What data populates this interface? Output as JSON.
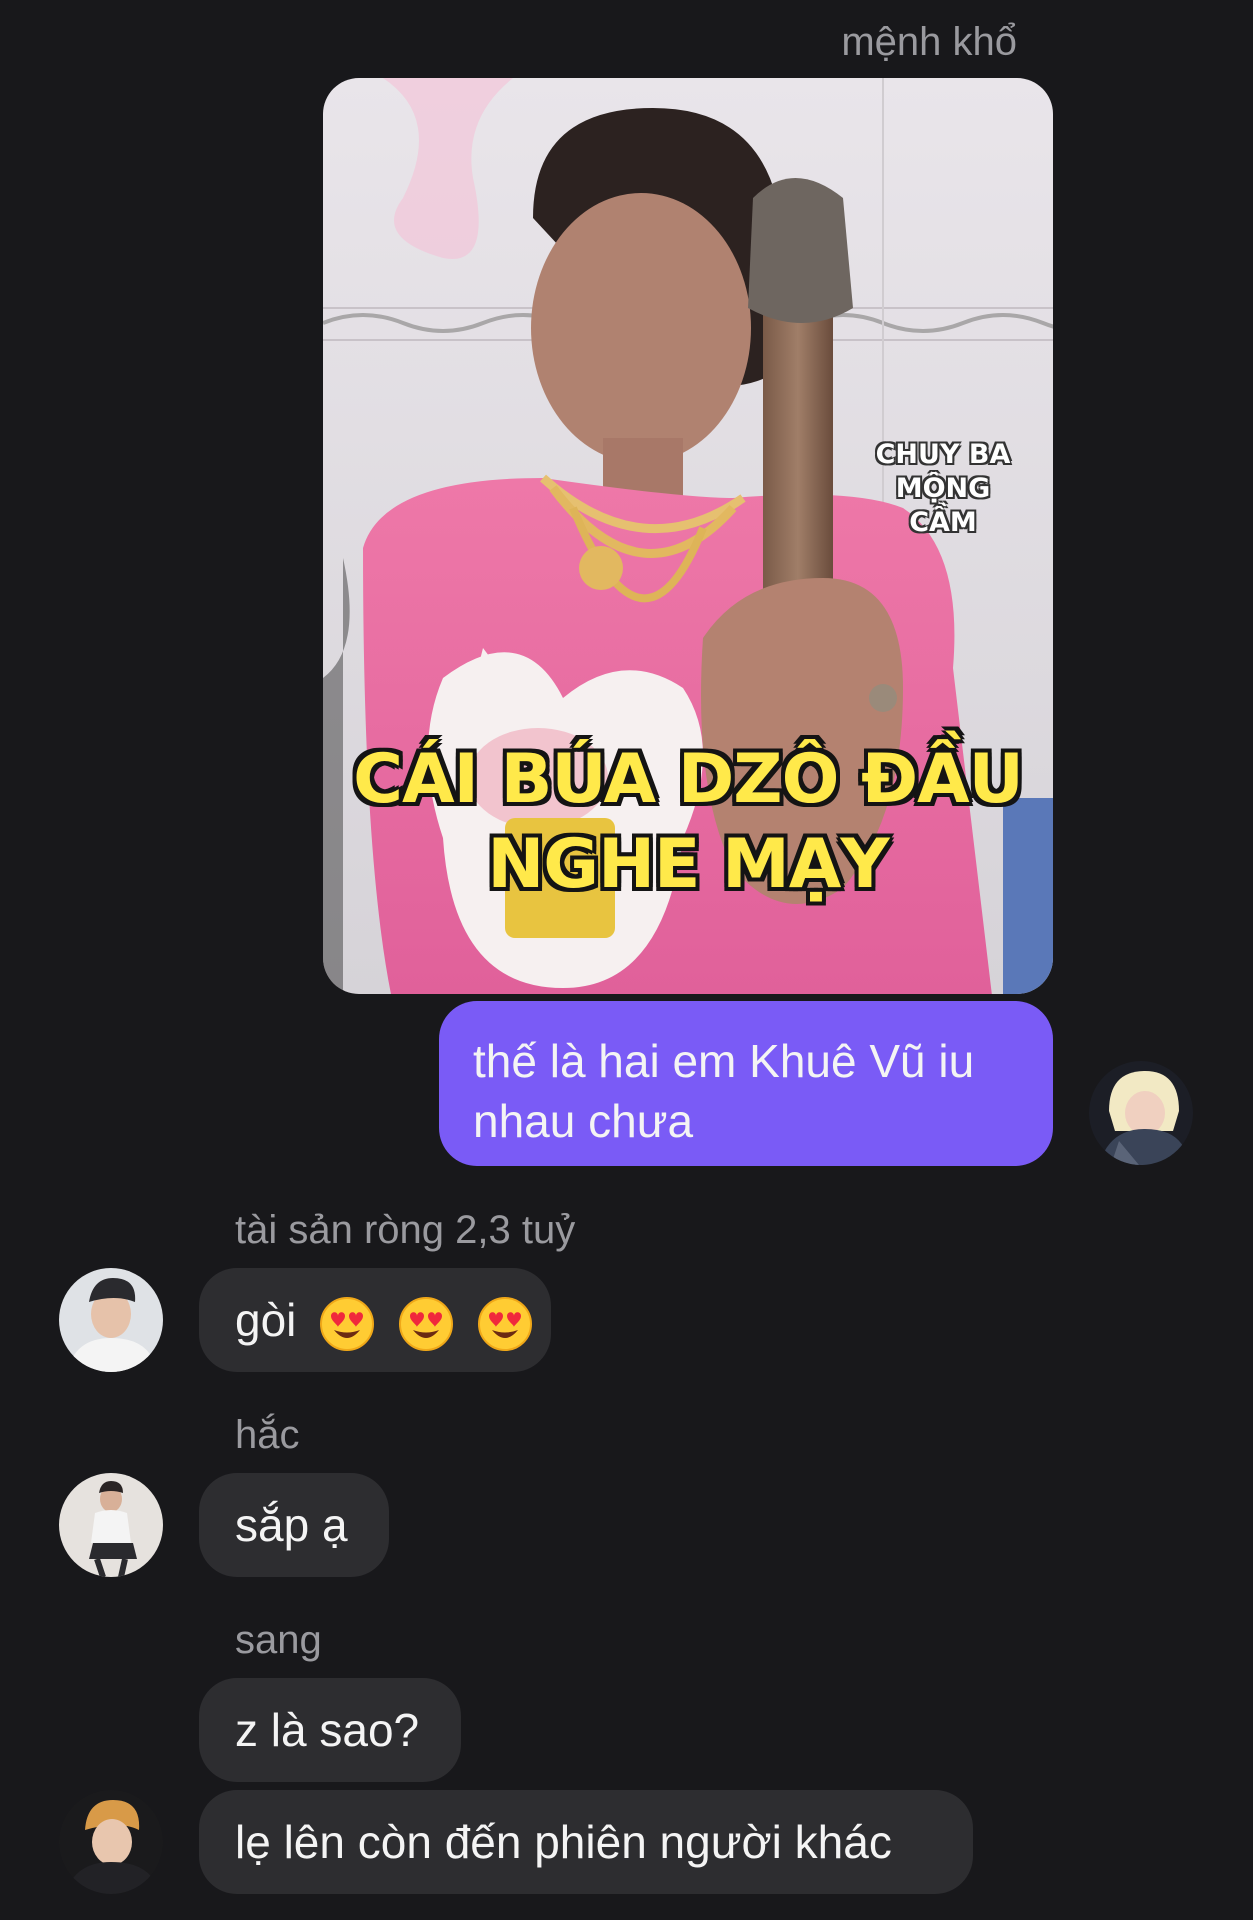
{
  "messages": {
    "outgoing": {
      "sender": "mệnh khổ",
      "image": {
        "watermark_line1": "CHUY BA",
        "watermark_line2": "MỘNG CẦM",
        "caption_line1": "CÁI BÚA DZÔ ĐẦU",
        "caption_line2": "NGHE MẠY"
      },
      "text": "thế là hai em Khuê Vũ iu nhau chưa"
    },
    "reply1": {
      "sender": "tài sản ròng 2,3 tuỷ",
      "text": "gòi",
      "emoji": "heart-eyes"
    },
    "reply2": {
      "sender": "hắc",
      "text": "sắp ạ"
    },
    "reply3": {
      "sender": "sang",
      "text1": "z là sao?",
      "text2": "lẹ lên còn đến phiên người khác"
    }
  },
  "colors": {
    "background": "#18181b",
    "outgoing_bubble": "#7a5bf6",
    "incoming_bubble": "#2d2d30",
    "sender_name": "#9a9a9f"
  }
}
